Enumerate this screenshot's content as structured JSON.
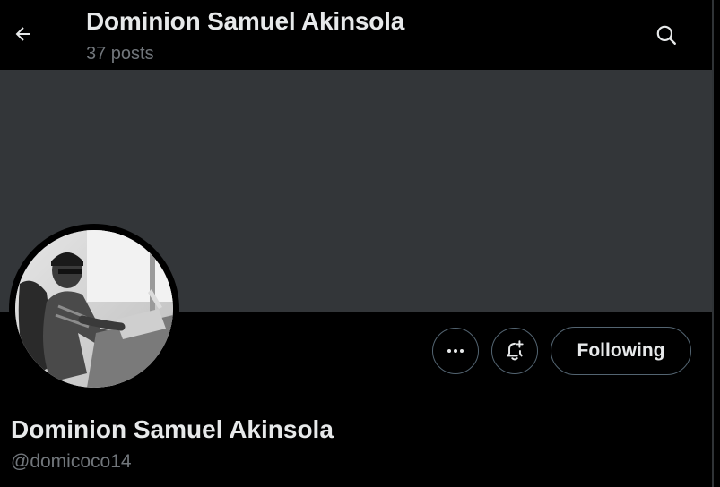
{
  "header": {
    "title": "Dominion Samuel Akinsola",
    "post_count": "37 posts",
    "back_icon": "arrow-left-icon",
    "search_icon": "search-icon"
  },
  "banner": {
    "color": "#333639"
  },
  "profile": {
    "name": "Dominion Samuel Akinsola",
    "handle": "@domicoco14",
    "avatar_description_icon": "avatar-photo"
  },
  "actions": {
    "more_icon": "more-horizontal-icon",
    "notify_icon": "bell-plus-icon",
    "following_label": "Following"
  },
  "colors": {
    "background": "#000000",
    "text_primary": "#e7e9ea",
    "text_secondary": "#71767b",
    "border": "#536471"
  }
}
